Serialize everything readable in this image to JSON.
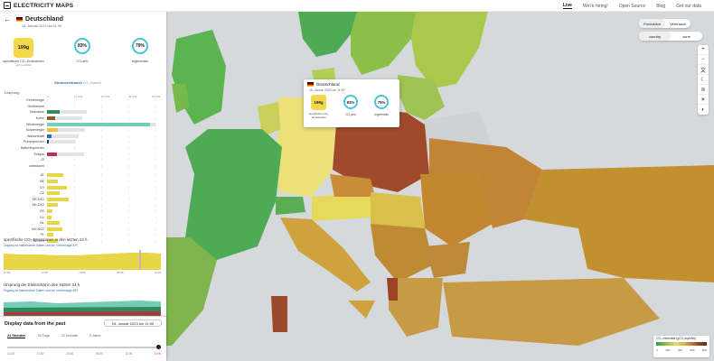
{
  "header": {
    "logo": "ELECTRICITY MAPS",
    "nav": [
      "Live",
      "We're hiring!",
      "Open Source",
      "Blog",
      "Get our data"
    ]
  },
  "zone": {
    "name": "Deutschland",
    "date": "15. Januar 2023 um 11:00"
  },
  "metrics": {
    "co2_value": "199g",
    "co2_label": "spezifische CO₂-Emissionen",
    "co2_sub": "gCO₂eq/kWh",
    "low_carbon_value": "83%",
    "low_carbon_label": "CO₂arm",
    "renewable_value": "79%",
    "renewable_label": "regenerativ",
    "low_carbon_fraction": 0.83,
    "renewable_fraction": 0.79
  },
  "toggle_label": "Stromverbrauch",
  "toggle_sub": "CO₂-Ausstoß",
  "origin_heading": "Ursprung",
  "axis_ticks": [
    "0",
    "10 GW",
    "20 GW",
    "30 GW",
    "40 GW"
  ],
  "sources": [
    {
      "label": "Kernenergie",
      "value": 0.0,
      "color": "#9b59b6"
    },
    {
      "label": "Geothermie",
      "value": 0.0,
      "color": "#cc6f3c"
    },
    {
      "label": "Biomasse",
      "value": 4.5,
      "color": "#2e8b57"
    },
    {
      "label": "Kohle",
      "value": 3.0,
      "color": "#8b5a2b"
    },
    {
      "label": "Windenergie",
      "value": 38.0,
      "color": "#74cdb9"
    },
    {
      "label": "Solarenergie",
      "value": 4.0,
      "color": "#f0c04a"
    },
    {
      "label": "Wasserkraft",
      "value": 1.5,
      "color": "#2f6db3"
    },
    {
      "label": "Pumpspeicher",
      "value": 0.6,
      "color": "#0e4e7a"
    },
    {
      "label": "Batteriespeicher",
      "value": 0.0,
      "color": "#b13f7c"
    },
    {
      "label": "Erdgas",
      "value": 3.5,
      "color": "#bc2e5a"
    },
    {
      "label": "Öl",
      "value": 0.0,
      "color": "#867d66"
    },
    {
      "label": "unbekannt",
      "value": 0.0,
      "color": "#aaaaaa"
    }
  ],
  "exchanges": [
    {
      "label": "AT",
      "value": 1.5
    },
    {
      "label": "BE",
      "value": 1.0
    },
    {
      "label": "CH",
      "value": 1.8
    },
    {
      "label": "CZ",
      "value": 1.2
    },
    {
      "label": "DK-DK1",
      "value": 2.0
    },
    {
      "label": "DK-DK2",
      "value": 1.0
    },
    {
      "label": "FR",
      "value": 0.5
    },
    {
      "label": "LU",
      "value": 0.4
    },
    {
      "label": "NL",
      "value": 1.2
    },
    {
      "label": "NO-NO2",
      "value": 1.4
    },
    {
      "label": "PL",
      "value": 0.6
    },
    {
      "label": "SE-SE4",
      "value": 1.0
    }
  ],
  "chart1": {
    "title": "spezifische CO₂-Emissionen in den letzten 24 h",
    "link": "Zugang zu historischen Daten und zur Vorhersage API",
    "ticks": [
      "11:00",
      "17:00",
      "23:00",
      "05:00",
      "11:00"
    ]
  },
  "chart2": {
    "title": "Ursprung der Elektrizität in den letzten 24 h",
    "link": "Zugang zu historischen Daten und zur Vorhersage API"
  },
  "past": {
    "title": "Display data from the past",
    "date": "15. Januar 2023 um 11:00",
    "tabs": [
      "24 Stunden",
      "30 Tage",
      "12 Monate",
      "5 Jahre"
    ],
    "times": [
      "11:00",
      "17:00",
      "23:00",
      "05:00",
      "11:00"
    ],
    "live": "LIVE"
  },
  "controls": {
    "production": "Produktion",
    "consumption": "Verbrauch",
    "country": "country",
    "zone": "zone"
  },
  "tooltip": {
    "name": "Deutschland",
    "date": "15. Januar 2023 um 11:00",
    "co2": "199g",
    "co2_label": "spezifische CO₂-Emissionen",
    "low": "83%",
    "low_label": "CO₂arm",
    "ren": "79%",
    "ren_label": "regenerativ"
  },
  "legend": {
    "title": "CO₂-Intensität (gCO₂eq/kWh)",
    "ticks": [
      "0",
      "200",
      "400",
      "600",
      "800"
    ]
  }
}
